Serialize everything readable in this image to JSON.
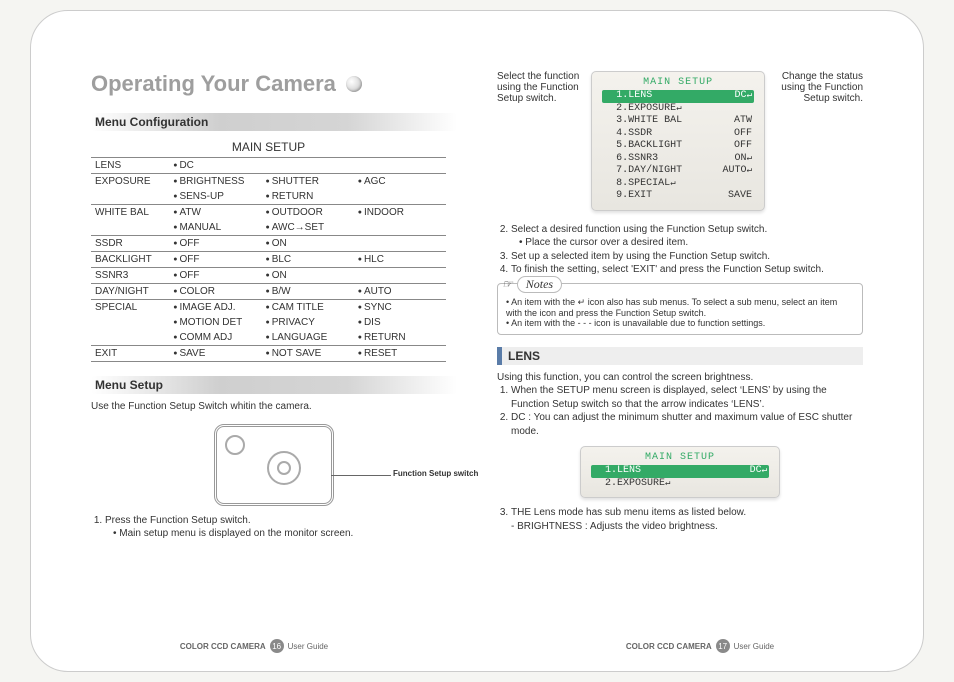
{
  "title": "Operating Your Camera",
  "left": {
    "menu_conf": "Menu Configuration",
    "main_setup": "MAIN SETUP",
    "rows": [
      {
        "k": "LENS",
        "v": [
          "DC"
        ]
      },
      {
        "k": "EXPOSURE",
        "v": [
          "BRIGHTNESS",
          "SHUTTER",
          "AGC",
          "SENS-UP",
          "RETURN"
        ]
      },
      {
        "k": "WHITE BAL",
        "v": [
          "ATW",
          "OUTDOOR",
          "INDOOR",
          "MANUAL",
          "AWC→SET"
        ]
      },
      {
        "k": "SSDR",
        "v": [
          "OFF",
          "ON"
        ]
      },
      {
        "k": "BACKLIGHT",
        "v": [
          "OFF",
          "BLC",
          "HLC"
        ]
      },
      {
        "k": "SSNR3",
        "v": [
          "OFF",
          "ON"
        ]
      },
      {
        "k": "DAY/NIGHT",
        "v": [
          "COLOR",
          "B/W",
          "AUTO"
        ]
      },
      {
        "k": "SPECIAL",
        "v": [
          "IMAGE ADJ.",
          "CAM TITLE",
          "SYNC",
          "MOTION DET",
          "PRIVACY",
          "DIS",
          "COMM ADJ",
          "LANGUAGE",
          "RETURN"
        ]
      },
      {
        "k": "EXIT",
        "v": [
          "SAVE",
          "NOT SAVE",
          "RESET"
        ]
      }
    ],
    "menu_setup": "Menu Setup",
    "menu_setup_text": "Use the Function Setup Switch whitin the camera.",
    "cam_caption": "Function Setup switch",
    "step1": "Press the Function Setup switch.",
    "step1a": "Main setup menu is displayed on the monitor screen."
  },
  "right": {
    "osd_title": "MAIN SETUP",
    "osd": [
      {
        "n": "1",
        "t": "LENS",
        "v": "DC",
        "hl": true,
        "cr": true
      },
      {
        "n": "2",
        "t": "EXPOSURE",
        "v": "",
        "cr": true
      },
      {
        "n": "3",
        "t": "WHITE BAL",
        "v": "ATW"
      },
      {
        "n": "4",
        "t": "SSDR",
        "v": "OFF"
      },
      {
        "n": "5",
        "t": "BACKLIGHT",
        "v": "OFF"
      },
      {
        "n": "6",
        "t": "SSNR3",
        "v": "ON",
        "cr": true
      },
      {
        "n": "7",
        "t": "DAY/NIGHT",
        "v": "AUTO",
        "cr": true
      },
      {
        "n": "8",
        "t": "SPECIAL",
        "v": "",
        "cr": true
      },
      {
        "n": "9",
        "t": "EXIT",
        "v": "SAVE"
      }
    ],
    "ann_left": "Select the function using the Function Setup switch.",
    "ann_right": "Change the status using the Function Setup switch.",
    "step2": "Select a desired function using the Function Setup switch.",
    "step2a": "Place the cursor over a desired item.",
    "step3": "Set up a selected item by using the Function Setup switch.",
    "step4": "To finish the setting, select 'EXIT' and press the Function Setup switch.",
    "notes_label": "Notes",
    "note1": "An item with the  ↵  icon also has sub menus. To select a sub menu, select an item with the icon and press the Function Setup switch.",
    "note2": "An item with the - - - icon is unavailable due to function settings.",
    "lens_head": "LENS",
    "lens_intro": "Using this function, you can control the screen brightness.",
    "lens1": "When the SETUP menu screen is displayed, select ‘LENS’ by using the Function Setup switch so that the arrow indicates ‘LENS’.",
    "lens2": "DC : You can adjust the minimum shutter and maximum value of ESC shutter mode.",
    "osd2_title": "MAIN SETUP",
    "osd2": [
      {
        "n": "1",
        "t": "LENS",
        "v": "DC",
        "hl": true,
        "cr": true
      },
      {
        "n": "2",
        "t": "EXPOSURE",
        "v": "",
        "cr": true
      }
    ],
    "lens3": "THE Lens mode has sub menu items as listed below.",
    "lens3a": "- BRIGHTNESS : Adjusts the video brightness."
  },
  "footer": {
    "product": "COLOR CCD CAMERA",
    "guide": "User Guide",
    "p_left": "16",
    "p_right": "17"
  }
}
